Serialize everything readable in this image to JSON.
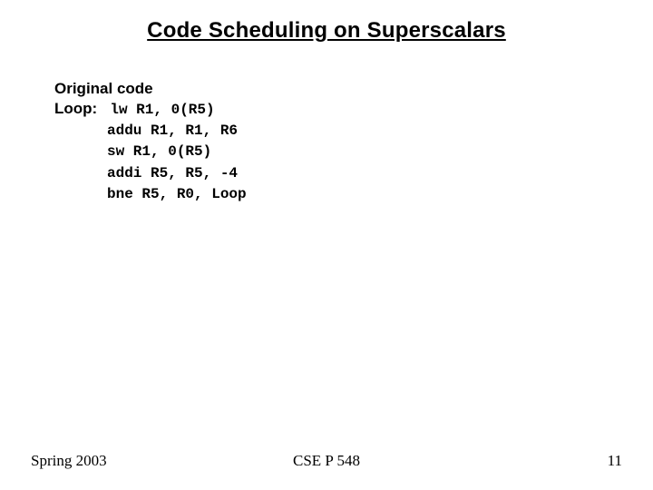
{
  "title": "Code Scheduling on Superscalars",
  "labels": {
    "original": "Original code",
    "loop": "Loop:   "
  },
  "code": {
    "line0": "lw R1, 0(R5)",
    "line1": "addu R1, R1, R6",
    "line2": "sw R1, 0(R5)",
    "line3": "addi R5, R5, -4",
    "line4": "bne R5, R0, Loop"
  },
  "footer": {
    "left": "Spring 2003",
    "center": "CSE P 548",
    "right": "11"
  }
}
